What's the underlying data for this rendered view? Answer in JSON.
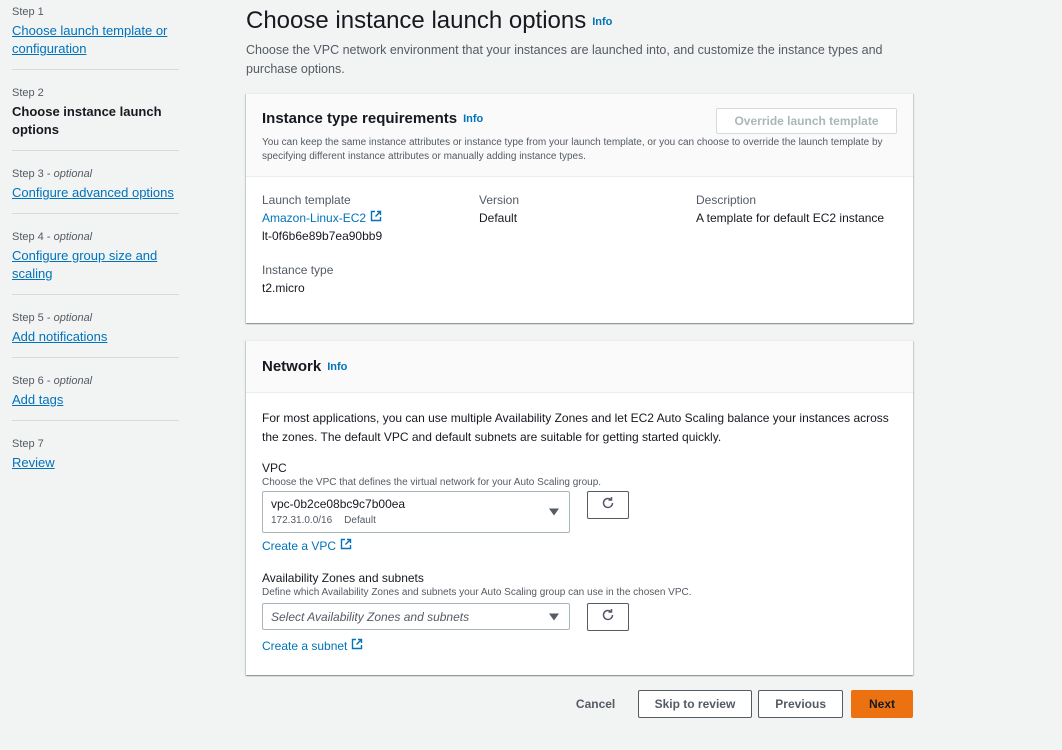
{
  "steps": [
    {
      "num": "Step 1",
      "optional": "",
      "label": "Choose launch template or configuration",
      "current": false
    },
    {
      "num": "Step 2",
      "optional": "",
      "label": "Choose instance launch options",
      "current": true
    },
    {
      "num": "Step 3",
      "optional": "optional",
      "label": "Configure advanced options",
      "current": false
    },
    {
      "num": "Step 4",
      "optional": "optional",
      "label": "Configure group size and scaling",
      "current": false
    },
    {
      "num": "Step 5",
      "optional": "optional",
      "label": "Add notifications",
      "current": false
    },
    {
      "num": "Step 6",
      "optional": "optional",
      "label": "Add tags",
      "current": false
    },
    {
      "num": "Step 7",
      "optional": "",
      "label": "Review",
      "current": false
    }
  ],
  "page": {
    "title": "Choose instance launch options",
    "info": "Info",
    "description": "Choose the VPC network environment that your instances are launched into, and customize the instance types and purchase options."
  },
  "instance_panel": {
    "title": "Instance type requirements",
    "info": "Info",
    "override_button": "Override launch template",
    "subtitle": "You can keep the same instance attributes or instance type from your launch template, or you can choose to override the launch template by specifying different instance attributes or manually adding instance types.",
    "launch_template_label": "Launch template",
    "launch_template_name": "Amazon-Linux-EC2",
    "launch_template_id": "lt-0f6b6e89b7ea90bb9",
    "version_label": "Version",
    "version_value": "Default",
    "description_label": "Description",
    "description_value": "A template for default EC2 instance",
    "instance_type_label": "Instance type",
    "instance_type_value": "t2.micro"
  },
  "network_panel": {
    "title": "Network",
    "info": "Info",
    "description": "For most applications, you can use multiple Availability Zones and let EC2 Auto Scaling balance your instances across the zones. The default VPC and default subnets are suitable for getting started quickly.",
    "vpc_label": "VPC",
    "vpc_desc": "Choose the VPC that defines the virtual network for your Auto Scaling group.",
    "vpc_value": "vpc-0b2ce08bc9c7b00ea",
    "vpc_cidr": "172.31.0.0/16",
    "vpc_tag": "Default",
    "create_vpc": "Create a VPC",
    "az_label": "Availability Zones and subnets",
    "az_desc": "Define which Availability Zones and subnets your Auto Scaling group can use in the chosen VPC.",
    "az_placeholder": "Select Availability Zones and subnets",
    "create_subnet": "Create a subnet"
  },
  "footer": {
    "cancel": "Cancel",
    "skip": "Skip to review",
    "previous": "Previous",
    "next": "Next"
  },
  "colors": {
    "link": "#0073bb",
    "primary": "#ec7211",
    "background": "#f2f3f3"
  }
}
